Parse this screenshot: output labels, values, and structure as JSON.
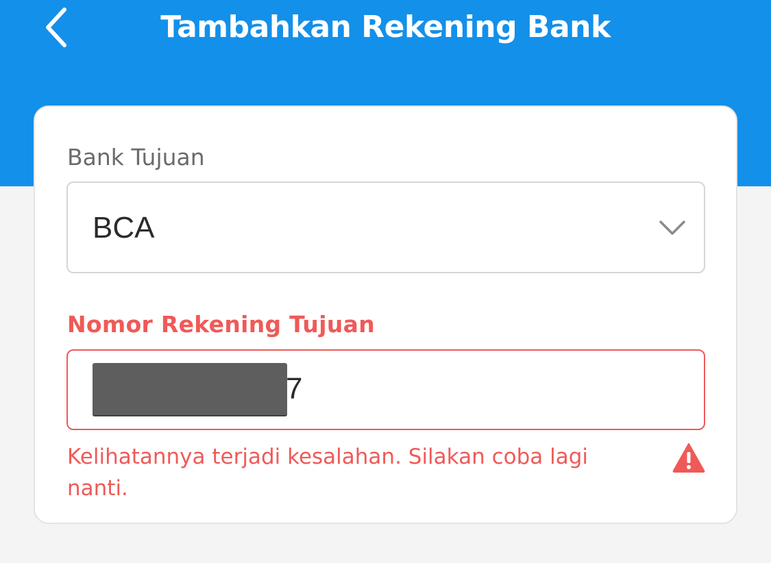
{
  "header": {
    "title": "Tambahkan Rekening Bank",
    "back_icon": "chevron-left-icon",
    "background_color": "#1390ea"
  },
  "form": {
    "bank_field": {
      "label": "Bank Tujuan",
      "selected_value": "BCA",
      "icon": "chevron-down-icon"
    },
    "account_field": {
      "label": "Nomor Rekening Tujuan",
      "visible_value_suffix": "7",
      "value_redacted": true,
      "state": "error"
    },
    "error": {
      "message": "Kelihatannya terjadi kesalahan. Silakan coba lagi nanti.",
      "icon": "warning-icon"
    }
  },
  "colors": {
    "error": "#ef5a58",
    "label": "#6b6b6b",
    "text": "#2b2b2b"
  }
}
